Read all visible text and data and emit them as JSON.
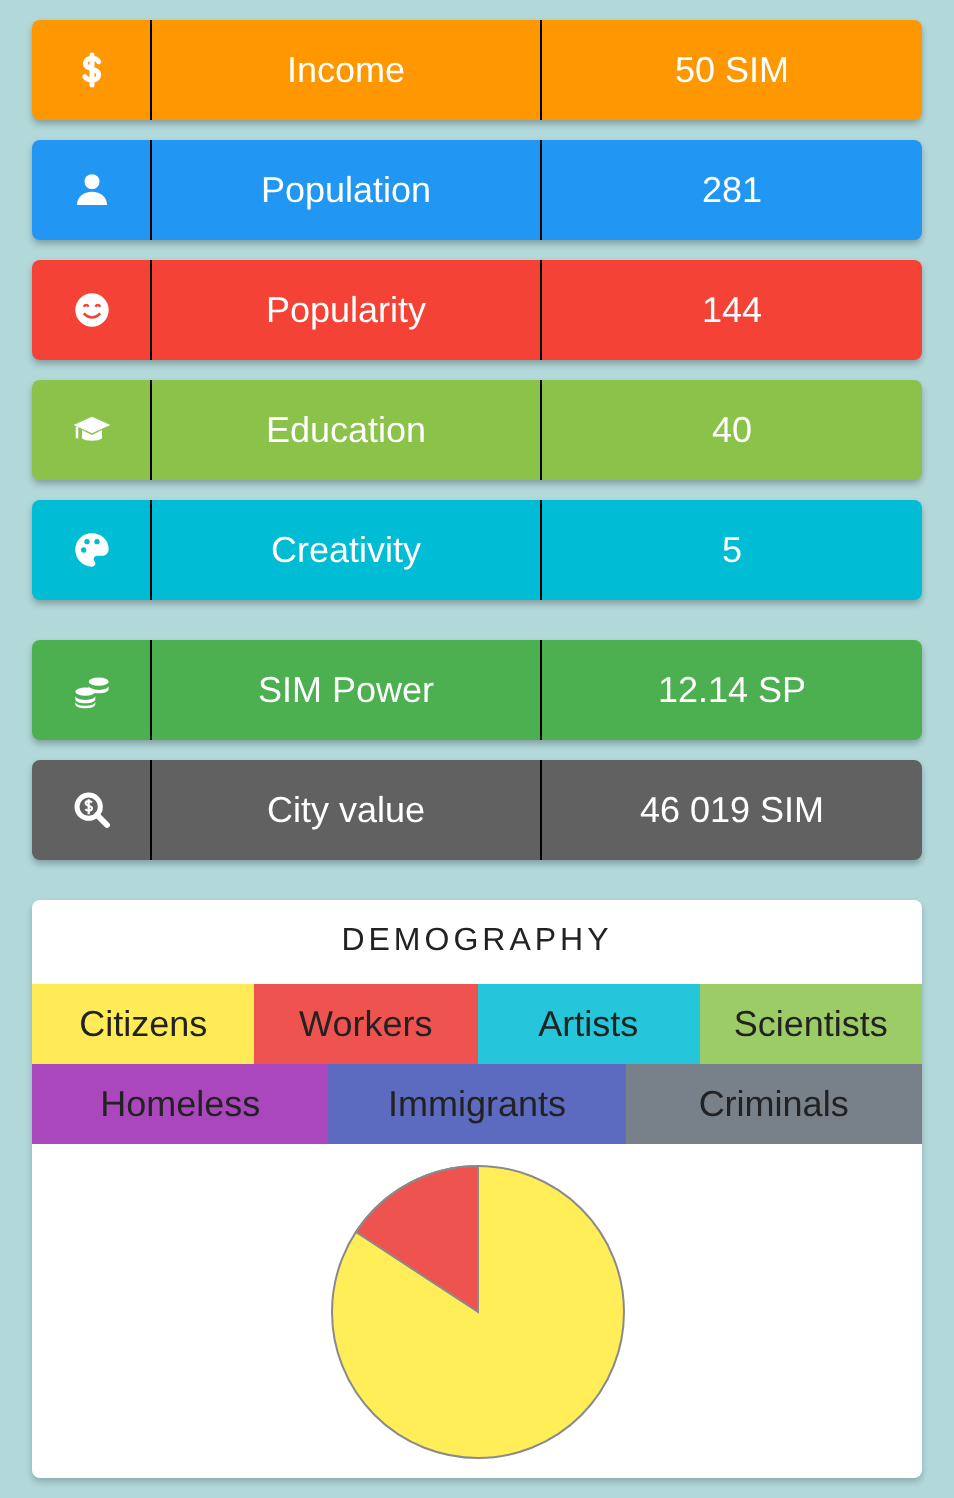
{
  "stat_groups": [
    [
      {
        "kind": "dollar",
        "label": "Income",
        "value": "50 SIM",
        "color": "#ff9800"
      },
      {
        "kind": "person",
        "label": "Population",
        "value": "281",
        "color": "#2196f3"
      },
      {
        "kind": "smile",
        "label": "Popularity",
        "value": "144",
        "color": "#f44336"
      },
      {
        "kind": "cap",
        "label": "Education",
        "value": "40",
        "color": "#8bc34a"
      },
      {
        "kind": "palette",
        "label": "Creativity",
        "value": "5",
        "color": "#00bcd4"
      }
    ],
    [
      {
        "kind": "coins",
        "label": "SIM Power",
        "value": "12.14 SP",
        "color": "#4caf50"
      },
      {
        "kind": "search-dollar",
        "label": "City value",
        "value": "46 019 SIM",
        "color": "#616161"
      }
    ]
  ],
  "demography": {
    "title": "DEMOGRAPHY",
    "legend_rows": [
      [
        {
          "label": "Citizens",
          "color": "#ffeb56"
        },
        {
          "label": "Workers",
          "color": "#ef5350"
        },
        {
          "label": "Artists",
          "color": "#26c6da"
        },
        {
          "label": "Scientists",
          "color": "#9ccc65"
        }
      ],
      [
        {
          "label": "Homeless",
          "color": "#ab47bc"
        },
        {
          "label": "Immigrants",
          "color": "#5c6bc0"
        },
        {
          "label": "Criminals",
          "color": "#78808a"
        }
      ]
    ],
    "chart": {
      "kind": "picture"
    }
  }
}
